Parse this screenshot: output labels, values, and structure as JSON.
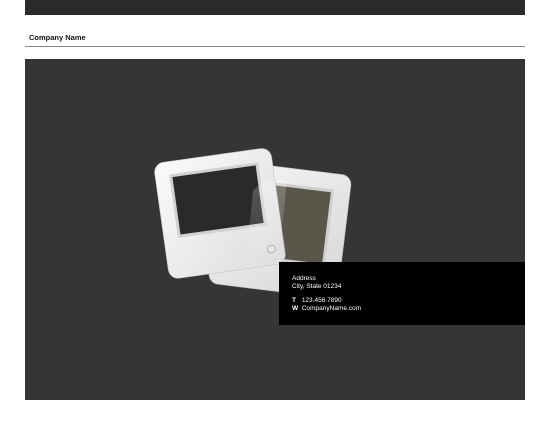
{
  "header": {
    "company_name": "Company Name"
  },
  "contact": {
    "address_line1": "Address",
    "address_line2": "City, State 01234",
    "phone_label": "T",
    "phone": "123.456.7890",
    "web_label": "W",
    "web": "CompanyName.com"
  },
  "colors": {
    "top_bar": "#2b2b2b",
    "panel": "#353535",
    "contact_box": "#000000",
    "rule": "#8a8a8a"
  },
  "illustration": {
    "icon": "photo-slides-icon"
  }
}
